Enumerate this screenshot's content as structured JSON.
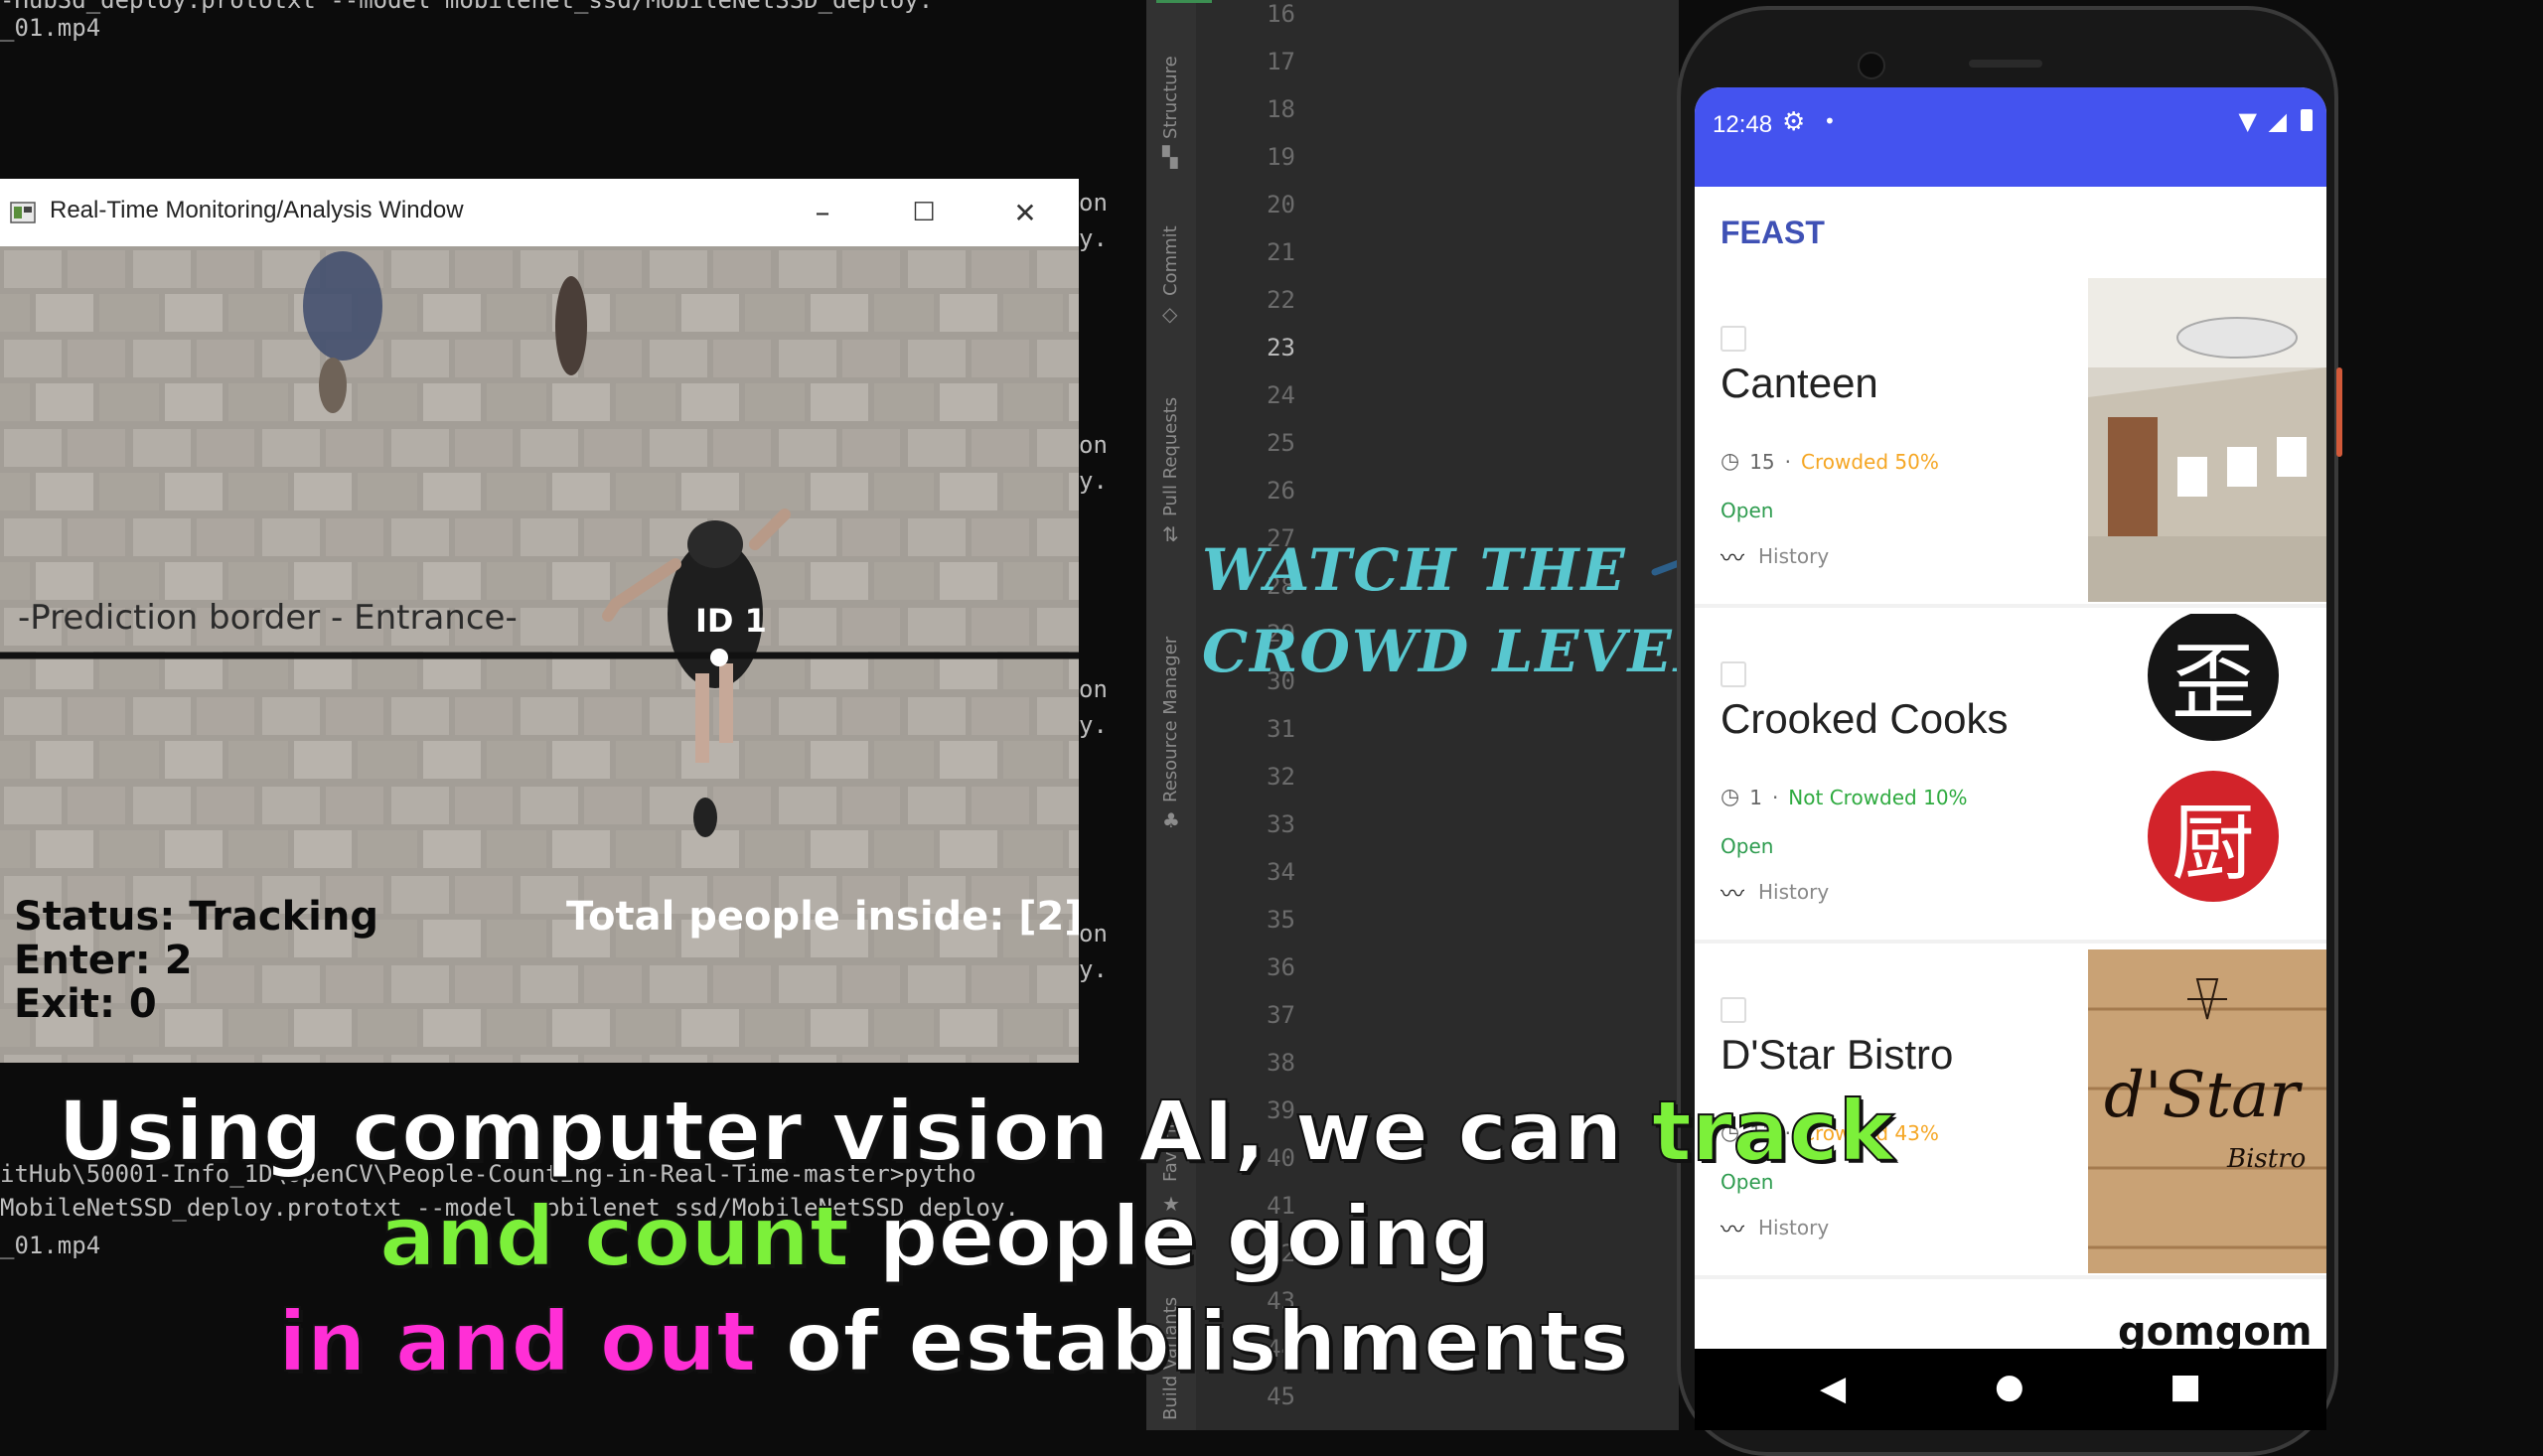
{
  "terminal": {
    "top_lines": [
      "-HubSd_deploy.prototxt --model mobilenet_ssd/MobileNetSSD_deploy.",
      "_01.mp4"
    ],
    "bottom_lines": [
      "itHub\\50001-Info_1D\\openCV\\People-Counting-in-Real-Time-master>pytho",
      "MobileNetSSD_deploy.prototxt --model mobilenet_ssd/MobileNetSSD_deploy.",
      "_01.mp4"
    ],
    "fragments": [
      "on",
      "y.",
      "on",
      "y.",
      "on",
      "y.",
      "on",
      "y."
    ]
  },
  "cv_window": {
    "title": "Real-Time Monitoring/Analysis Window",
    "controls": {
      "minimize": "–",
      "maximize": "☐",
      "close": "✕"
    },
    "overlay": {
      "border_label": "-Prediction border - Entrance-",
      "track_id": "ID 1",
      "status": "Status: Tracking",
      "enter": "Enter: 2",
      "exit": "Exit: 0",
      "total": "Total people inside: [2]"
    }
  },
  "ide": {
    "tool_windows": [
      "Structure",
      "Commit",
      "Pull Requests",
      "Resource Manager",
      "Favorites",
      "Build Variants"
    ],
    "line_numbers": [
      "16",
      "17",
      "18",
      "19",
      "20",
      "21",
      "22",
      "23",
      "24",
      "25",
      "26",
      "27",
      "28",
      "29",
      "30",
      "31",
      "32",
      "33",
      "34",
      "35",
      "36",
      "37",
      "38",
      "39",
      "40",
      "41",
      "42",
      "43",
      "44",
      "45"
    ],
    "current_line": "23"
  },
  "callout": {
    "line1": "WATCH THE",
    "line2": "CROWD LEVEL!",
    "color": "#58c7cf"
  },
  "phone": {
    "status_time": "12:48",
    "app_title": "FEAST",
    "accent": "#4453ef",
    "cards": [
      {
        "name": "Canteen",
        "wait": "15",
        "crowd": "Crowded 50%",
        "crowd_color": "#f5a623",
        "open": "Open",
        "history": "History"
      },
      {
        "name": "Crooked Cooks",
        "wait": "1",
        "crowd": "Not Crowded 10%",
        "crowd_color": "#2eaa3f",
        "open": "Open",
        "history": "History"
      },
      {
        "name": "D'Star Bistro",
        "wait": "11",
        "crowd": "Crowded 43%",
        "crowd_color": "#f5a623",
        "open": "Open",
        "history": "History"
      }
    ],
    "partial_next": "gomgom",
    "logos": {
      "crooked_top": "歪",
      "crooked_bottom": "厨",
      "dstar": "d'Star",
      "dstar_sub": "Bistro"
    }
  },
  "subtitle": {
    "l1_white": "Using computer vision AI, we can ",
    "l1_green": "track",
    "l2_green": "and count",
    "l2_white": " people going",
    "l3_magenta": "in and out",
    "l3_white": " of establishments",
    "green": "#7cf03a",
    "magenta": "#ff2fd6"
  }
}
